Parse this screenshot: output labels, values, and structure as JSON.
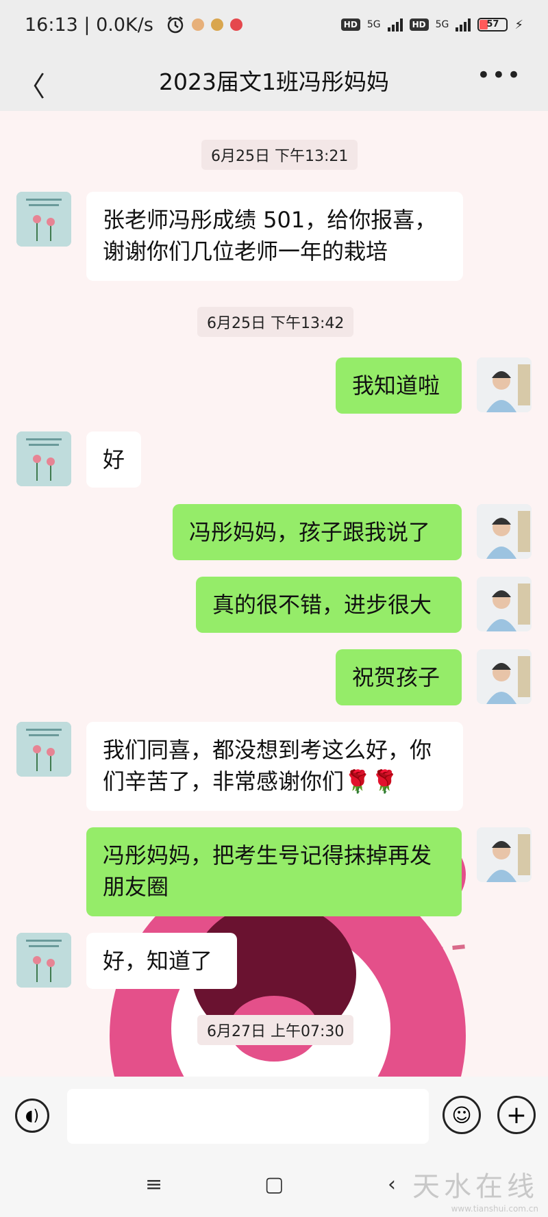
{
  "status_bar": {
    "time": "16:13 | 0.0K/s",
    "hd1": "HD",
    "net1": "5G",
    "hd2": "HD",
    "net2": "5G",
    "battery": "57"
  },
  "header": {
    "title": "2023届文1班冯彤妈妈"
  },
  "messages": [
    {
      "type": "time",
      "text": "6月25日 下午13:21"
    },
    {
      "type": "in",
      "text": "张老师冯彤成绩 501，给你报喜，谢谢你们几位老师一年的栽培"
    },
    {
      "type": "time",
      "text": "6月25日 下午13:42"
    },
    {
      "type": "out",
      "text": "我知道啦"
    },
    {
      "type": "in",
      "text": "好"
    },
    {
      "type": "out",
      "text": "冯彤妈妈，孩子跟我说了"
    },
    {
      "type": "out",
      "text": "真的很不错，进步很大"
    },
    {
      "type": "out",
      "text": "祝贺孩子"
    },
    {
      "type": "in",
      "text": "我们同喜，都没想到考这么好，你们辛苦了，非常感谢你们🌹🌹"
    },
    {
      "type": "out",
      "text": "冯彤妈妈，把考生号记得抹掉再发朋友圈"
    },
    {
      "type": "in",
      "text": "好，知道了"
    },
    {
      "type": "time",
      "text": "6月27日 上午07:30"
    }
  ],
  "watermark": {
    "text": "天水在线",
    "url": "www.tianshui.com.cn"
  },
  "colors": {
    "outgoing_bubble": "#95ec69",
    "incoming_bubble": "#ffffff",
    "bar_background": "#ededed"
  }
}
